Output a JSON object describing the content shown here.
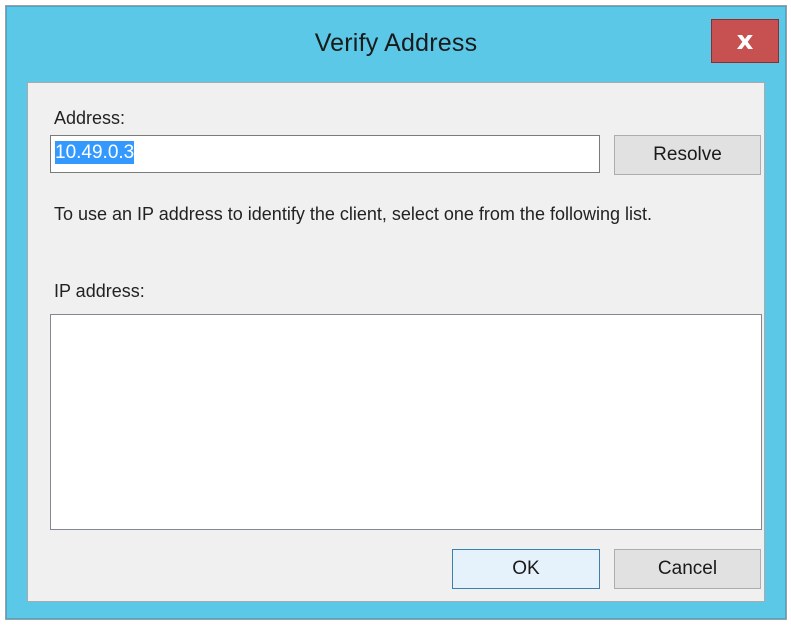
{
  "window": {
    "title": "Verify Address",
    "close_glyph": "x"
  },
  "address": {
    "label": "Address:",
    "value": "10.49.0.3",
    "resolve_label": "Resolve"
  },
  "instruction": "To use an IP address to identify the client, select one from the following list.",
  "ip_list": {
    "label": "IP address:",
    "items": []
  },
  "buttons": {
    "ok_label": "OK",
    "cancel_label": "Cancel"
  },
  "colors": {
    "titlebar": "#5bc8e8",
    "close_button": "#c75050",
    "selection": "#3399ff"
  }
}
